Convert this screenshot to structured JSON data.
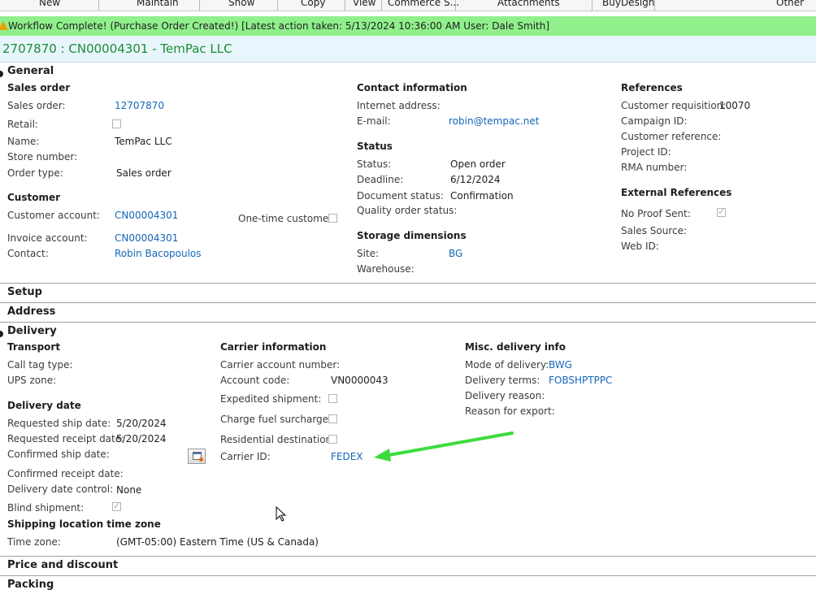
{
  "ribbon": {
    "tabs": [
      "New",
      "Maintain",
      "Show",
      "Copy",
      "View",
      "Commerce S...",
      "Attachments",
      "BuyDesign",
      "Other"
    ]
  },
  "banner": {
    "text": "Workflow Complete! (Purchase Order Created!)  [Latest action taken: 5/13/2024 10:36:00 AM  User: Dale Smith]",
    "color": "#90f08c"
  },
  "title": "2707870 : CN00004301 - TemPac LLC",
  "general": {
    "heading": "General",
    "sales_order": {
      "heading": "Sales order",
      "sales_order_label": "Sales order:",
      "sales_order_value": "12707870",
      "retail_label": "Retail:",
      "name_label": "Name:",
      "name_value": "TemPac LLC",
      "store_label": "Store number:",
      "order_type_label": "Order type:",
      "order_type_value": "Sales order"
    },
    "customer": {
      "heading": "Customer",
      "account_label": "Customer account:",
      "account_value": "CN00004301",
      "one_time_label": "One-time customer:",
      "invoice_label": "Invoice account:",
      "invoice_value": "CN00004301",
      "contact_label": "Contact:",
      "contact_value": "Robin Bacopoulos"
    },
    "contact_info": {
      "heading": "Contact information",
      "internet_label": "Internet address:",
      "email_label": "E-mail:",
      "email_value": "robin@tempac.net"
    },
    "status": {
      "heading": "Status",
      "status_label": "Status:",
      "status_value": "Open order",
      "deadline_label": "Deadline:",
      "deadline_value": "6/12/2024",
      "doc_status_label": "Document status:",
      "doc_status_value": "Confirmation",
      "quality_label": "Quality order status:"
    },
    "storage": {
      "heading": "Storage dimensions",
      "site_label": "Site:",
      "site_value": "BG",
      "warehouse_label": "Warehouse:"
    },
    "references": {
      "heading": "References",
      "cust_req_label": "Customer requisition:",
      "cust_req_value": "10070",
      "campaign_label": "Campaign ID:",
      "cust_ref_label": "Customer reference:",
      "project_label": "Project ID:",
      "rma_label": "RMA number:"
    },
    "external": {
      "heading": "External References",
      "no_proof_label": "No Proof Sent:",
      "sales_source_label": "Sales Source:",
      "web_id_label": "Web ID:"
    }
  },
  "sections": {
    "setup": "Setup",
    "address": "Address",
    "delivery": "Delivery",
    "price": "Price and discount",
    "packing": "Packing"
  },
  "delivery": {
    "transport": {
      "heading": "Transport",
      "call_tag_label": "Call tag type:",
      "ups_zone_label": "UPS zone:"
    },
    "delivery_date": {
      "heading": "Delivery date",
      "req_ship_label": "Requested ship date:",
      "req_ship_value": "5/20/2024",
      "req_receipt_label": "Requested receipt date:",
      "req_receipt_value": "5/20/2024",
      "conf_ship_label": "Confirmed ship date:",
      "conf_receipt_label": "Confirmed receipt date:",
      "date_control_label": "Delivery date control:",
      "date_control_value": "None",
      "blind_label": "Blind shipment:"
    },
    "shipping_tz": {
      "heading": "Shipping location time zone",
      "tz_label": "Time zone:",
      "tz_value": "(GMT-05:00) Eastern Time (US & Canada)"
    },
    "carrier": {
      "heading": "Carrier information",
      "acct_num_label": "Carrier account number:",
      "acct_code_label": "Account code:",
      "acct_code_value": "VN0000043",
      "expedited_label": "Expedited shipment:",
      "fuel_label": "Charge fuel surcharge:",
      "residential_label": "Residential destination:",
      "carrier_id_label": "Carrier ID:",
      "carrier_id_value": "FEDEX"
    },
    "misc": {
      "heading": "Misc. delivery info",
      "mode_label": "Mode of delivery:",
      "mode_value": "BWG",
      "terms_label": "Delivery terms:",
      "terms_value": "FOBSHPTPPC",
      "reason_label": "Delivery reason:",
      "export_label": "Reason for export:"
    }
  },
  "annotation": {
    "arrow_color": "#3ddc3d"
  }
}
